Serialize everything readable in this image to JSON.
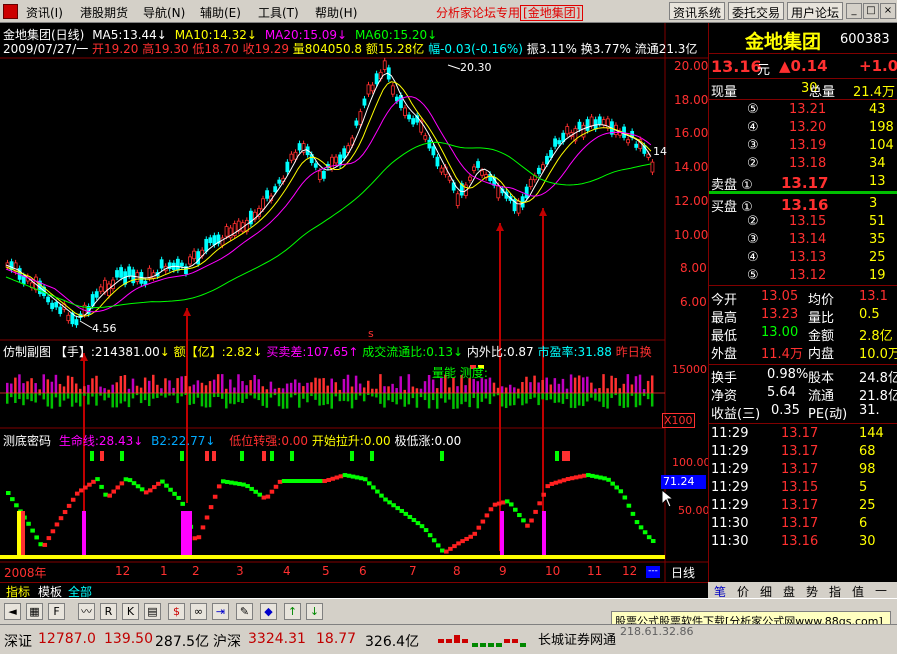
{
  "menu": {
    "items": [
      "资讯(I)",
      "港股期货",
      "导航(N)",
      "辅助(E)",
      "工具(T)",
      "帮助(H)"
    ],
    "title_prefix": "分析家论坛专用",
    "title_box": "[金地集团]",
    "buttons": [
      "资讯系统",
      "委托交易",
      "用户论坛"
    ]
  },
  "header": {
    "line1_name": "金地集团(日线)",
    "ma5": "MA5:13.44",
    "ma10": "MA10:14.32",
    "ma20": "MA20:15.09",
    "ma60": "MA60:15.20",
    "line2_date": "2009/07/27/一",
    "open": "开19.20",
    "high": "高19.30",
    "low": "低18.70",
    "close": "收19.29",
    "vol": "量804050.8",
    "amount": "额15.28亿",
    "change": "幅-0.03(-0.16%)",
    "amp": "振3.11%",
    "turn": "换3.77%",
    "float": "流通21.3亿"
  },
  "price_axis": [
    "20.00",
    "18.00",
    "16.00",
    "14.00",
    "12.00",
    "10.00",
    "8.00",
    "6.00"
  ],
  "annotations": {
    "high": "20.30",
    "low": "4.56",
    "last_marker": "14"
  },
  "vol_header": {
    "name": "仿制副图",
    "shou": "【手】:214381.00",
    "e": "额【亿】:2.82",
    "mmc": "买卖差:107.65",
    "ltb": "成交流通比:0.13",
    "nwp": "内外比:0.87",
    "syl": "市盈率:31.88",
    "zr": "昨日换",
    "overlay": "量能 测度:"
  },
  "vol_axis": [
    "15000",
    "X100"
  ],
  "ind_header": {
    "name": "测底密码",
    "sml": "生命线:28.43",
    "b2": "B2:22.77",
    "dwzq": "低位转强:0.00",
    "ksls": "开始拉升:0.00",
    "jdz": "极低涨:0.00"
  },
  "ind_axis": [
    "100.00",
    "50.00"
  ],
  "ind_value": "71.24",
  "time_axis": {
    "labels": [
      "2008年",
      "12",
      "1",
      "2",
      "3",
      "4",
      "5",
      "6",
      "7",
      "8",
      "9",
      "10",
      "11",
      "12"
    ],
    "period": "日线"
  },
  "tabs": [
    "指标",
    "模板",
    "全部"
  ],
  "quote": {
    "name": "金地集团",
    "code": "600383",
    "price": "13.16",
    "unit": "元",
    "change": "▲0.14",
    "change2": "+1.0",
    "xianliang_label": "现量",
    "xianliang": "30",
    "zongliang_label": "总量",
    "zongliang": "21.4万",
    "asks": [
      {
        "label": "⑤",
        "price": "13.21",
        "vol": "43"
      },
      {
        "label": "④",
        "price": "13.20",
        "vol": "198"
      },
      {
        "label": "③",
        "price": "13.19",
        "vol": "104"
      },
      {
        "label": "②",
        "price": "13.18",
        "vol": "34"
      },
      {
        "label": "卖盘 ①",
        "price": "13.17",
        "vol": "13"
      }
    ],
    "bids": [
      {
        "label": "买盘 ①",
        "price": "13.16",
        "vol": "3"
      },
      {
        "label": "②",
        "price": "13.15",
        "vol": "51"
      },
      {
        "label": "③",
        "price": "13.14",
        "vol": "35"
      },
      {
        "label": "④",
        "price": "13.13",
        "vol": "25"
      },
      {
        "label": "⑤",
        "price": "13.12",
        "vol": "19"
      }
    ],
    "stats": [
      {
        "l1": "今开",
        "v1": "13.05",
        "l2": "均价",
        "v2": "13.1"
      },
      {
        "l1": "最高",
        "v1": "13.23",
        "l2": "量比",
        "v2": "0.5"
      },
      {
        "l1": "最低",
        "v1": "13.00",
        "l2": "金额",
        "v2": "2.8亿"
      },
      {
        "l1": "外盘",
        "v1": "11.4万",
        "l2": "内盘",
        "v2": "10.0万"
      }
    ],
    "stats2": [
      {
        "l1": "换手",
        "v1": "0.98%",
        "l2": "股本",
        "v2": "24.8亿"
      },
      {
        "l1": "净资",
        "v1": "5.64",
        "l2": "流通",
        "v2": "21.8亿"
      },
      {
        "l1": "收益(三)",
        "v1": "0.35",
        "l2": "PE(动)",
        "v2": "31."
      }
    ],
    "ticks": [
      {
        "t": "11:29",
        "p": "13.17",
        "v": "144"
      },
      {
        "t": "11:29",
        "p": "13.17",
        "v": "68"
      },
      {
        "t": "11:29",
        "p": "13.17",
        "v": "98"
      },
      {
        "t": "11:29",
        "p": "13.15",
        "v": "5"
      },
      {
        "t": "11:29",
        "p": "13.17",
        "v": "25"
      },
      {
        "t": "11:30",
        "p": "13.17",
        "v": "6"
      },
      {
        "t": "11:30",
        "p": "13.16",
        "v": "30"
      }
    ],
    "rtabs": [
      "笔",
      "价",
      "细",
      "盘",
      "势",
      "指",
      "值",
      "—"
    ]
  },
  "ad_text": "股票公式股票软件下载[分析家公式网www.88gs.com]",
  "status": {
    "sz_label": "深证",
    "sz_value": "12787.0",
    "sz_change": "139.50",
    "sz_amount": "287.5亿",
    "hs_label": "沪深",
    "hs_value": "3324.31",
    "hs_change": "18.77",
    "hs_amount": "326.4亿",
    "broker": "长城证券网通",
    "ip": "218.61.32.86"
  }
}
